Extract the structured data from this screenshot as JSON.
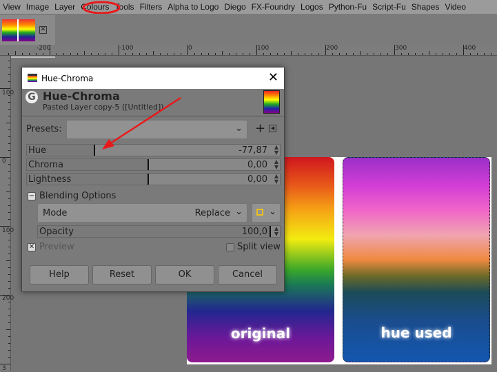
{
  "menu": [
    "View",
    "Image",
    "Layer",
    "Colours",
    "Tools",
    "Filters",
    "Alpha to Logo",
    "Diego",
    "FX-Foundry",
    "Logos",
    "Python-Fu",
    "Script-Fu",
    "Shapes",
    "Video"
  ],
  "ruler_h": [
    "-200",
    "-100",
    "0",
    "100",
    "200",
    "300",
    "400"
  ],
  "ruler_v": [
    "100",
    "0",
    "100",
    "200",
    "3"
  ],
  "dialog": {
    "window_title": "Hue-Chroma",
    "title": "Hue-Chroma",
    "subtitle": "Pasted Layer copy-5 ([Untitled])",
    "presets_label": "Presets:",
    "add": "+",
    "hue_label": "Hue",
    "hue_value": "-77,87",
    "chroma_label": "Chroma",
    "chroma_value": "0,00",
    "lightness_label": "Lightness",
    "lightness_value": "0,00",
    "blending_label": "Blending Options",
    "mode_label": "Mode",
    "mode_value": "Replace",
    "opacity_label": "Opacity",
    "opacity_value": "100,0",
    "preview_label": "Preview",
    "split_label": "Split view",
    "buttons": [
      "Help",
      "Reset",
      "OK",
      "Cancel"
    ]
  },
  "canvas": {
    "original": "original",
    "hue_used": "hue used"
  },
  "colors": {
    "annotation": "#e8191b"
  }
}
